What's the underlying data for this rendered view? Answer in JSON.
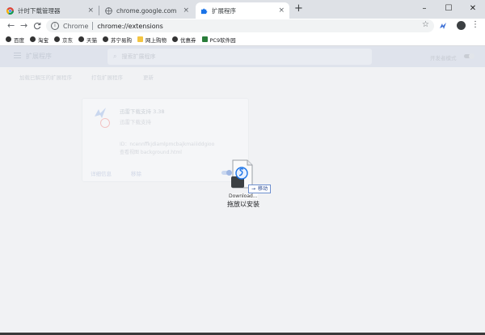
{
  "tabs": [
    {
      "title": "计时下载管理器",
      "active": false
    },
    {
      "title": "chrome.google.com",
      "active": false
    },
    {
      "title": "扩展程序",
      "active": true
    }
  ],
  "tab_close_glyph": "×",
  "new_tab_glyph": "+",
  "window_controls": {
    "minimize": "–",
    "maximize": "☐",
    "close": "✕"
  },
  "toolbar": {
    "back_glyph": "←",
    "forward_glyph": "→",
    "reload_glyph": "C",
    "address_chrome": "Chrome",
    "address_url": "chrome://extensions",
    "star_glyph": "☆",
    "menu_glyph": "⋮"
  },
  "bookmarks": [
    {
      "label": "百度",
      "icon": "globe-icon"
    },
    {
      "label": "淘宝",
      "icon": "globe-icon"
    },
    {
      "label": "京东",
      "icon": "globe-icon"
    },
    {
      "label": "天猫",
      "icon": "globe-icon"
    },
    {
      "label": "苏宁易购",
      "icon": "globe-icon"
    },
    {
      "label": "网上购物",
      "icon": "folder-icon"
    },
    {
      "label": "优惠券",
      "icon": "globe-icon"
    },
    {
      "label": "PC9软件园",
      "icon": "pc9-icon"
    }
  ],
  "extensions_page": {
    "title": "扩展程序",
    "search_placeholder": "搜索扩展程序",
    "dev_mode_label": "开发者模式",
    "subtabs": [
      "加载已解压的扩展程序",
      "打包扩展程序",
      "更新"
    ],
    "card": {
      "name": "迅雷下载支持",
      "version": "3.38",
      "description": "迅雷下载支持",
      "id_line": "ID：ncennffkjdiamlpmcbajkmaiiiddgioo",
      "view_line": "查看视图 background.html",
      "details_button": "详细信息",
      "remove_button": "移除"
    }
  },
  "drag": {
    "file_name": "Download...",
    "move_badge": "移动",
    "move_arrow": "→",
    "drop_hint": "拖放以安装"
  },
  "colors": {
    "tabstrip": "#dee1e6",
    "appbar": "#dfe3ec",
    "accent": "#1a73e8"
  }
}
